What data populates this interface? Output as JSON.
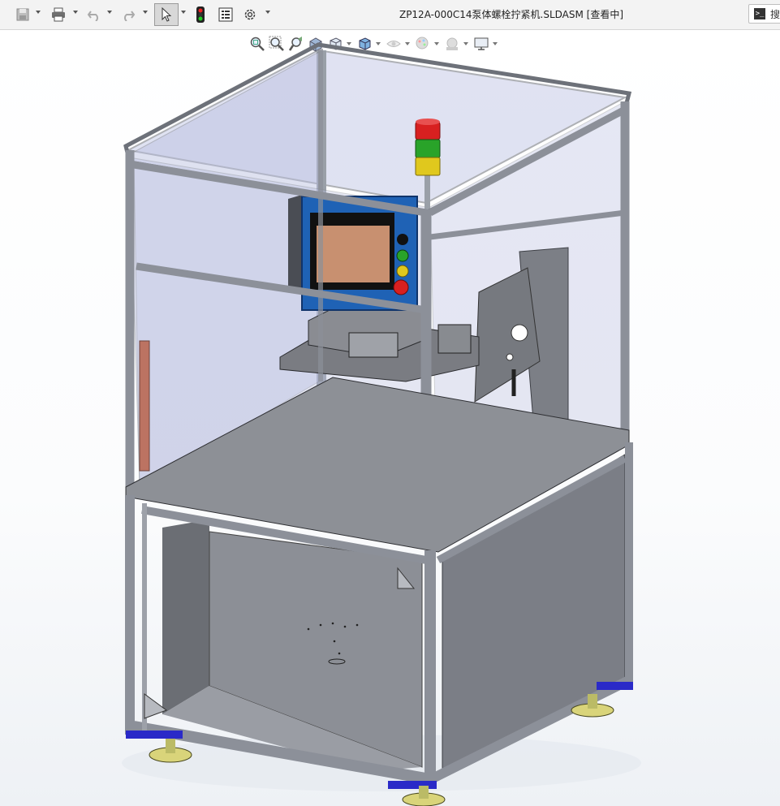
{
  "window": {
    "title": "ZP12A-000C14泵体螺栓拧紧机.SLDASM [查看中]",
    "search_label": "搜"
  },
  "toolbar": {
    "items": [
      "save-icon",
      "print-icon",
      "undo-icon",
      "redo-icon",
      "select-pointer-icon",
      "traffic-light-icon",
      "file-properties-icon",
      "options-gear-icon"
    ]
  },
  "heads_up": {
    "items": [
      "zoom-to-fit-icon",
      "zoom-to-area-icon",
      "previous-view-icon",
      "section-view-icon",
      "view-orientation-icon",
      "display-style-icon",
      "hide-show-icon",
      "edit-appearance-icon",
      "apply-scene-icon",
      "view-settings-icon"
    ]
  },
  "colors": {
    "frame": "#8c9099",
    "frame_dark": "#5b5f66",
    "panel": "#b9bee0",
    "plate": "#6e7075",
    "hmi_blue": "#1f62b5",
    "hmi_screen": "#c89070",
    "part_green": "#3bbf3b",
    "foot_blue": "#2a2ac8",
    "light_red": "#d82020",
    "light_green": "#29a329",
    "light_yellow": "#e0c81d"
  }
}
